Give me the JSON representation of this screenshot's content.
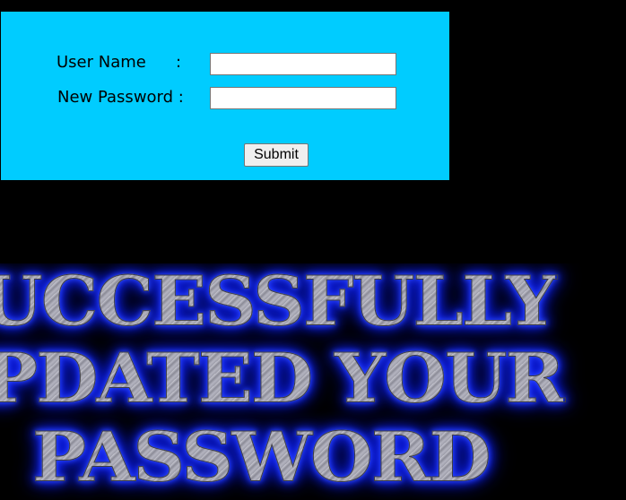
{
  "form": {
    "username_label": "User Name",
    "username_colon": ":",
    "username_value": "",
    "password_label": "New Password :",
    "password_value": "",
    "submit_label": "Submit"
  },
  "banner": {
    "lines": [
      "UCCESSFULLY",
      "PDATED YOUR",
      "PASSWORD"
    ]
  },
  "colors": {
    "page_background": "#000000",
    "form_background": "#00ccff",
    "banner_glow": "#1a2cff"
  }
}
